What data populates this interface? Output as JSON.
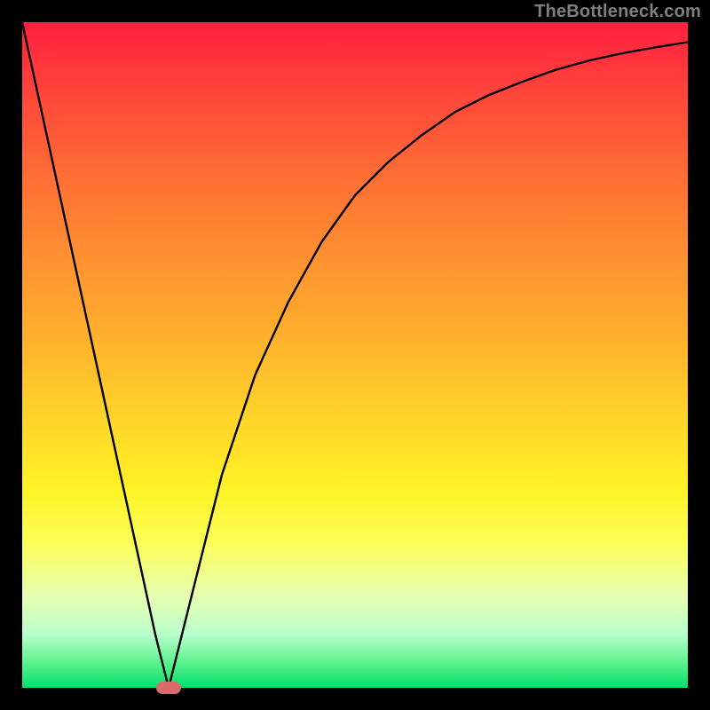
{
  "attribution": "TheBottleneck.com",
  "chart_data": {
    "type": "line",
    "title": "",
    "xlabel": "",
    "ylabel": "",
    "xlim": [
      0,
      100
    ],
    "ylim": [
      0,
      100
    ],
    "grid": false,
    "series": [
      {
        "name": "curve",
        "x": [
          0,
          5,
          10,
          15,
          20,
          22,
          25,
          30,
          35,
          40,
          45,
          50,
          55,
          60,
          65,
          70,
          75,
          80,
          85,
          90,
          95,
          100
        ],
        "values": [
          100,
          77,
          54,
          31,
          8,
          0,
          12,
          32,
          47,
          58,
          67,
          74,
          79,
          83,
          86.5,
          89,
          91,
          92.8,
          94.2,
          95.3,
          96.2,
          97
        ]
      }
    ],
    "marker": {
      "x": 22,
      "y": 0
    },
    "gradient_colors": {
      "top": "#ff1f3f",
      "mid": "#ffd02a",
      "bottom": "#00e070"
    }
  }
}
